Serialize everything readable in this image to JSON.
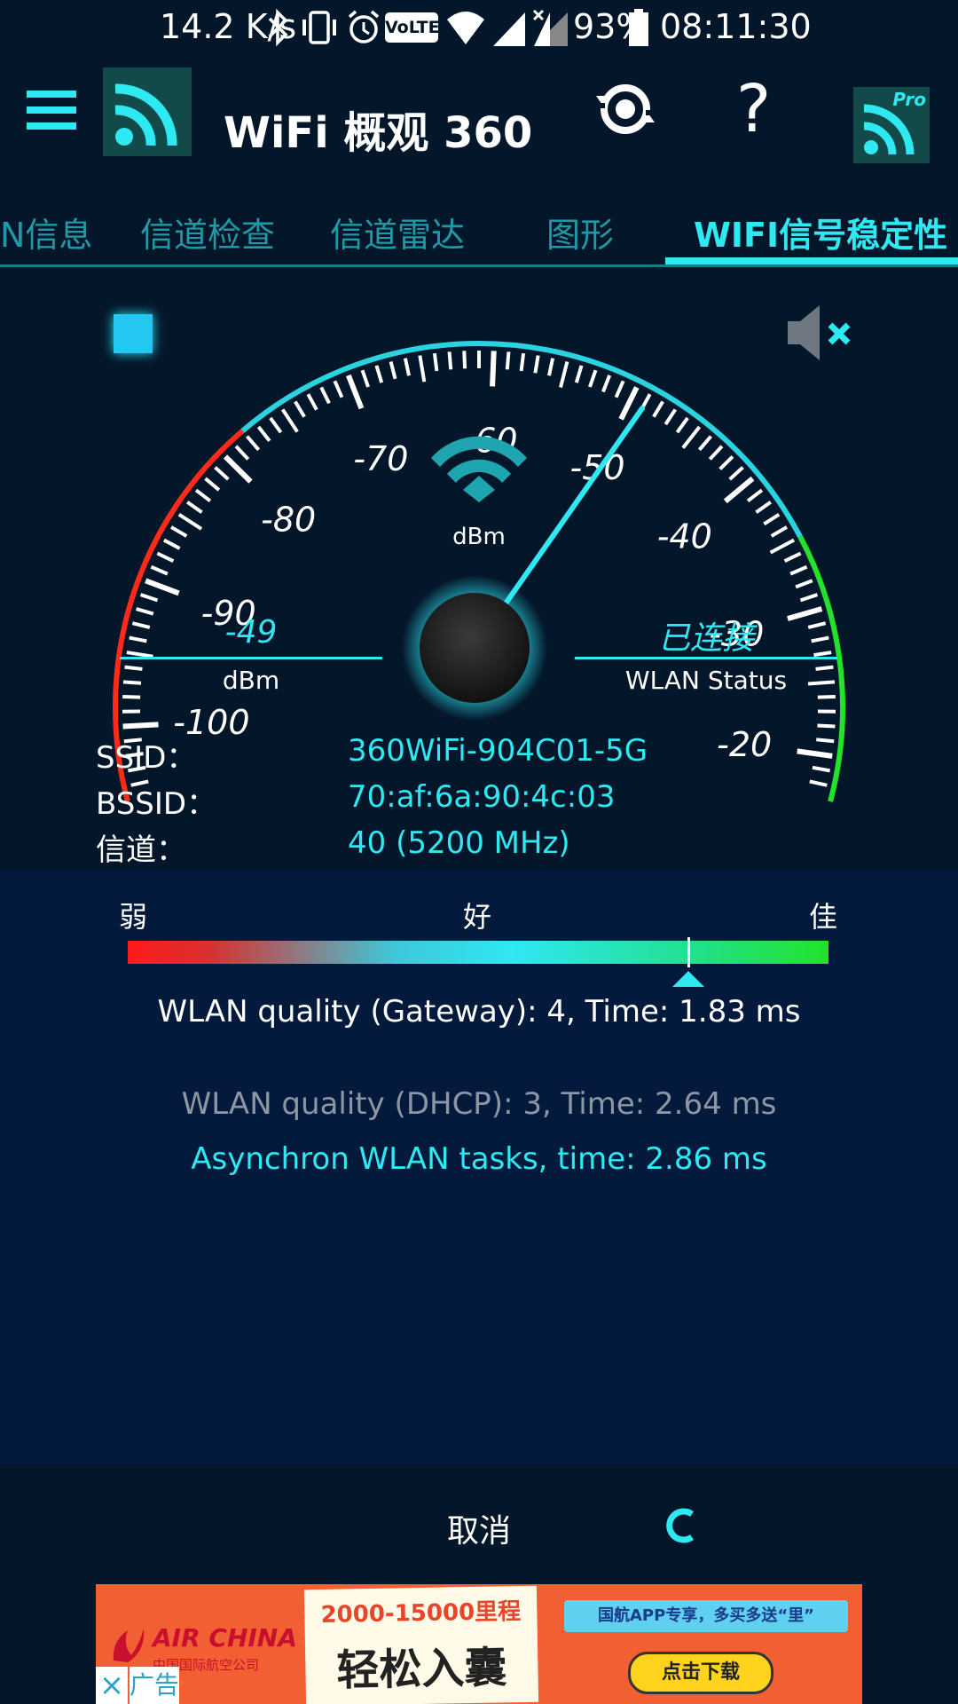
{
  "status_bar": {
    "speed": "14.2 K/s",
    "battery": "93%",
    "time": "08:11:30",
    "volte": "VoLTE",
    "icons": [
      "bluetooth-icon",
      "vibrate-icon",
      "alarm-icon",
      "volte-icon",
      "wifi-icon",
      "signal-icon",
      "signal-x-icon",
      "battery-icon"
    ]
  },
  "app_bar": {
    "title": "WiFi 概观 360",
    "icons": [
      "menu-icon",
      "wifi-logo-icon",
      "refresh-icon",
      "help-icon",
      "pro-icon"
    ],
    "help_glyph": "?",
    "pro_label": "Pro"
  },
  "tabs": [
    {
      "label": "N信息"
    },
    {
      "label": "信道检查"
    },
    {
      "label": "信道雷达"
    },
    {
      "label": "图形"
    },
    {
      "label": "WIFI信号稳定性",
      "active": true
    }
  ],
  "gauge": {
    "unit": "dBm",
    "scale_labels": [
      "-100",
      "-90",
      "-80",
      "-70",
      "-60",
      "-50",
      "-40",
      "-30",
      "-20"
    ],
    "needle_value": -49,
    "signal_value": "-49",
    "signal_unit": "dBm",
    "status_value": "已连接",
    "status_label": "WLAN Status",
    "colors": {
      "weak": "#ff2a1a",
      "mid": "#29d3e0",
      "strong": "#22e22a"
    }
  },
  "info": {
    "ssid_label": "SSID：",
    "ssid_value": "360WiFi-904C01-5G",
    "bssid_label": "BSSID：",
    "bssid_value": "70:af:6a:90:4c:03",
    "channel_label": "信道：",
    "channel_value": "40 (5200 MHz)"
  },
  "quality": {
    "weak": "弱",
    "good": "好",
    "best": "佳",
    "level": 0.8,
    "gateway_text": "WLAN quality (Gateway): 4, Time: 1.83 ms",
    "dhcp_text": "WLAN quality (DHCP): 3, Time: 2.64 ms",
    "async_text": "Asynchron WLAN tasks, time: 2.86 ms"
  },
  "bottom": {
    "cancel": "取消"
  },
  "ad": {
    "brand": "AIR CHINA",
    "brand_cn": "中国国际航空公司",
    "headline": "2000-15000里程",
    "big_text": "轻松入囊",
    "promo": "国航APP专享，多买多送“里”",
    "cta": "点击下载",
    "close": "×",
    "tag": "广告"
  }
}
